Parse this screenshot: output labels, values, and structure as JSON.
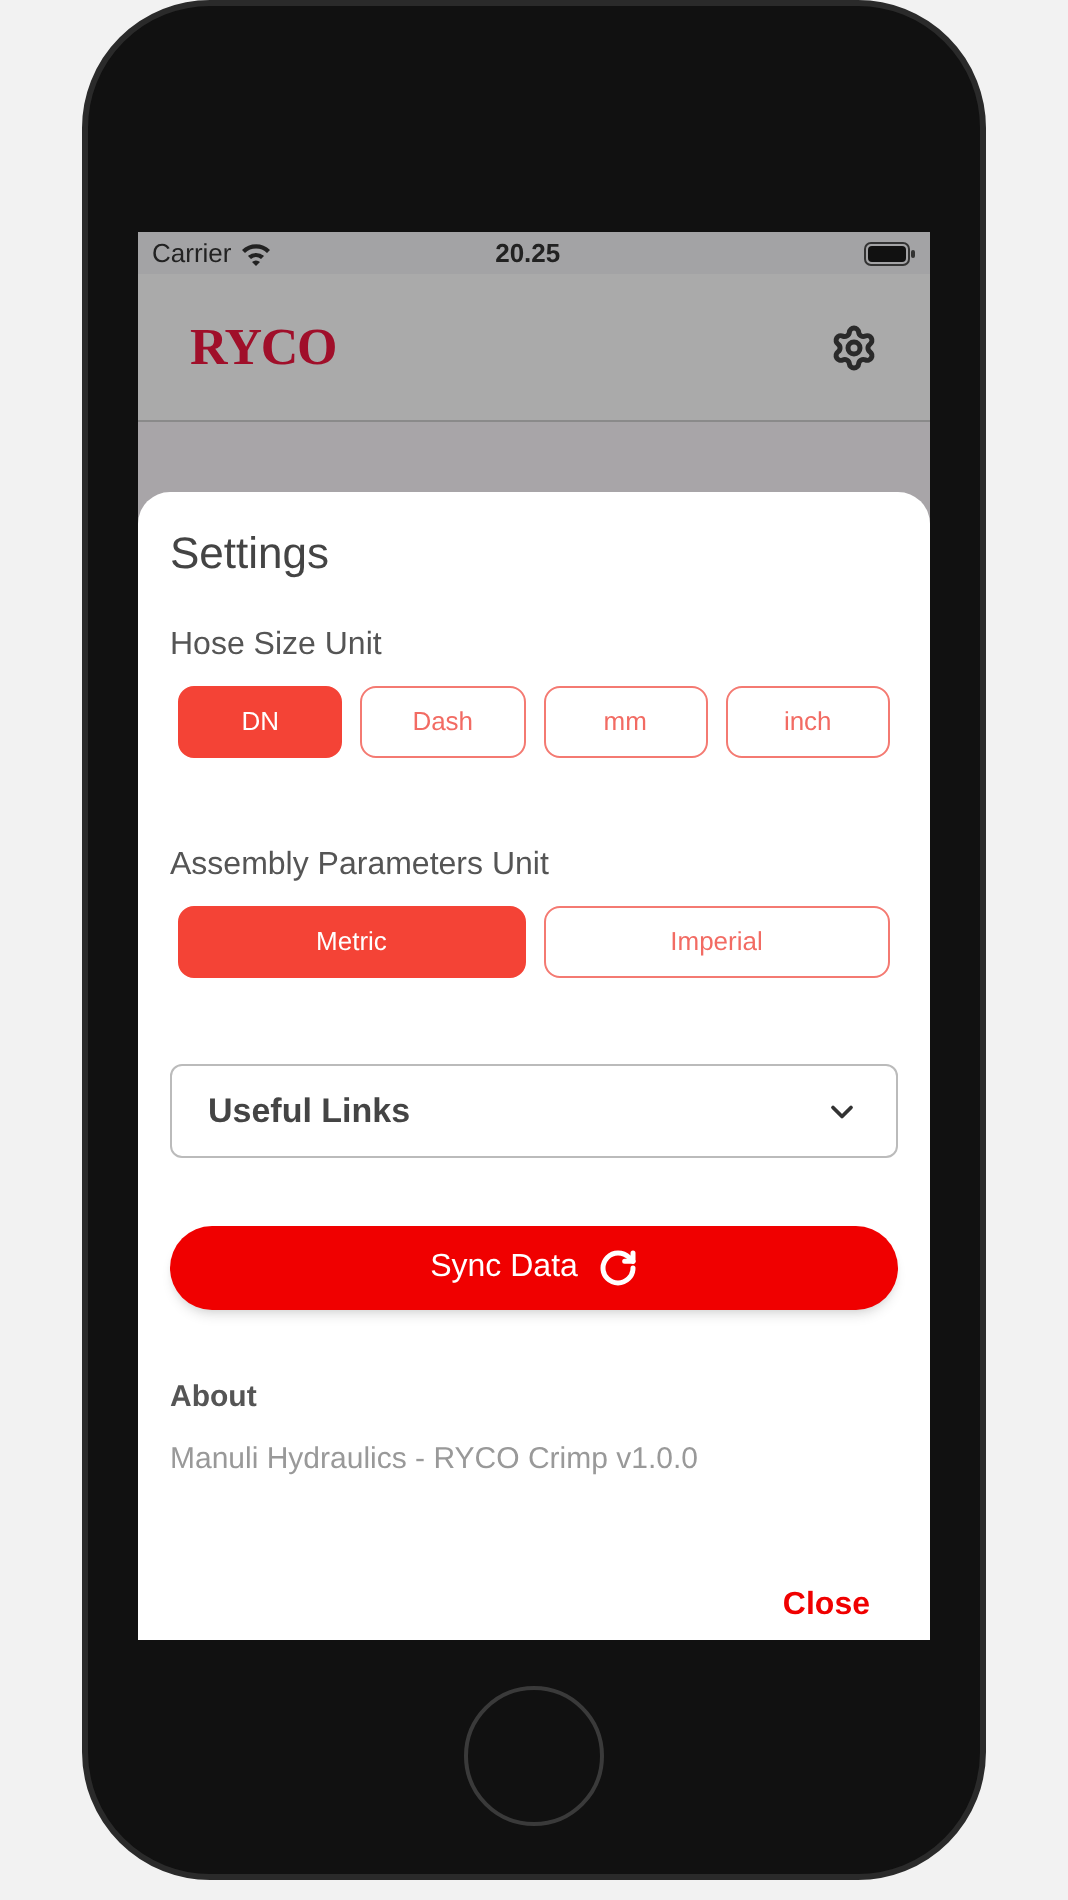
{
  "status_bar": {
    "carrier": "Carrier",
    "time": "20.25"
  },
  "header": {
    "logo": "RYCO"
  },
  "settings": {
    "title": "Settings",
    "hose_size_unit": {
      "label": "Hose Size Unit",
      "options": [
        {
          "label": "DN",
          "selected": true
        },
        {
          "label": "Dash",
          "selected": false
        },
        {
          "label": "mm",
          "selected": false
        },
        {
          "label": "inch",
          "selected": false
        }
      ]
    },
    "assembly_parameters_unit": {
      "label": "Assembly Parameters Unit",
      "options": [
        {
          "label": "Metric",
          "selected": true
        },
        {
          "label": "Imperial",
          "selected": false
        }
      ]
    },
    "useful_links": {
      "label": "Useful Links",
      "expanded": false
    },
    "sync_button": "Sync Data",
    "about": {
      "label": "About",
      "text": "Manuli Hydraulics - RYCO Crimp v1.0.0"
    },
    "close_button": "Close"
  }
}
